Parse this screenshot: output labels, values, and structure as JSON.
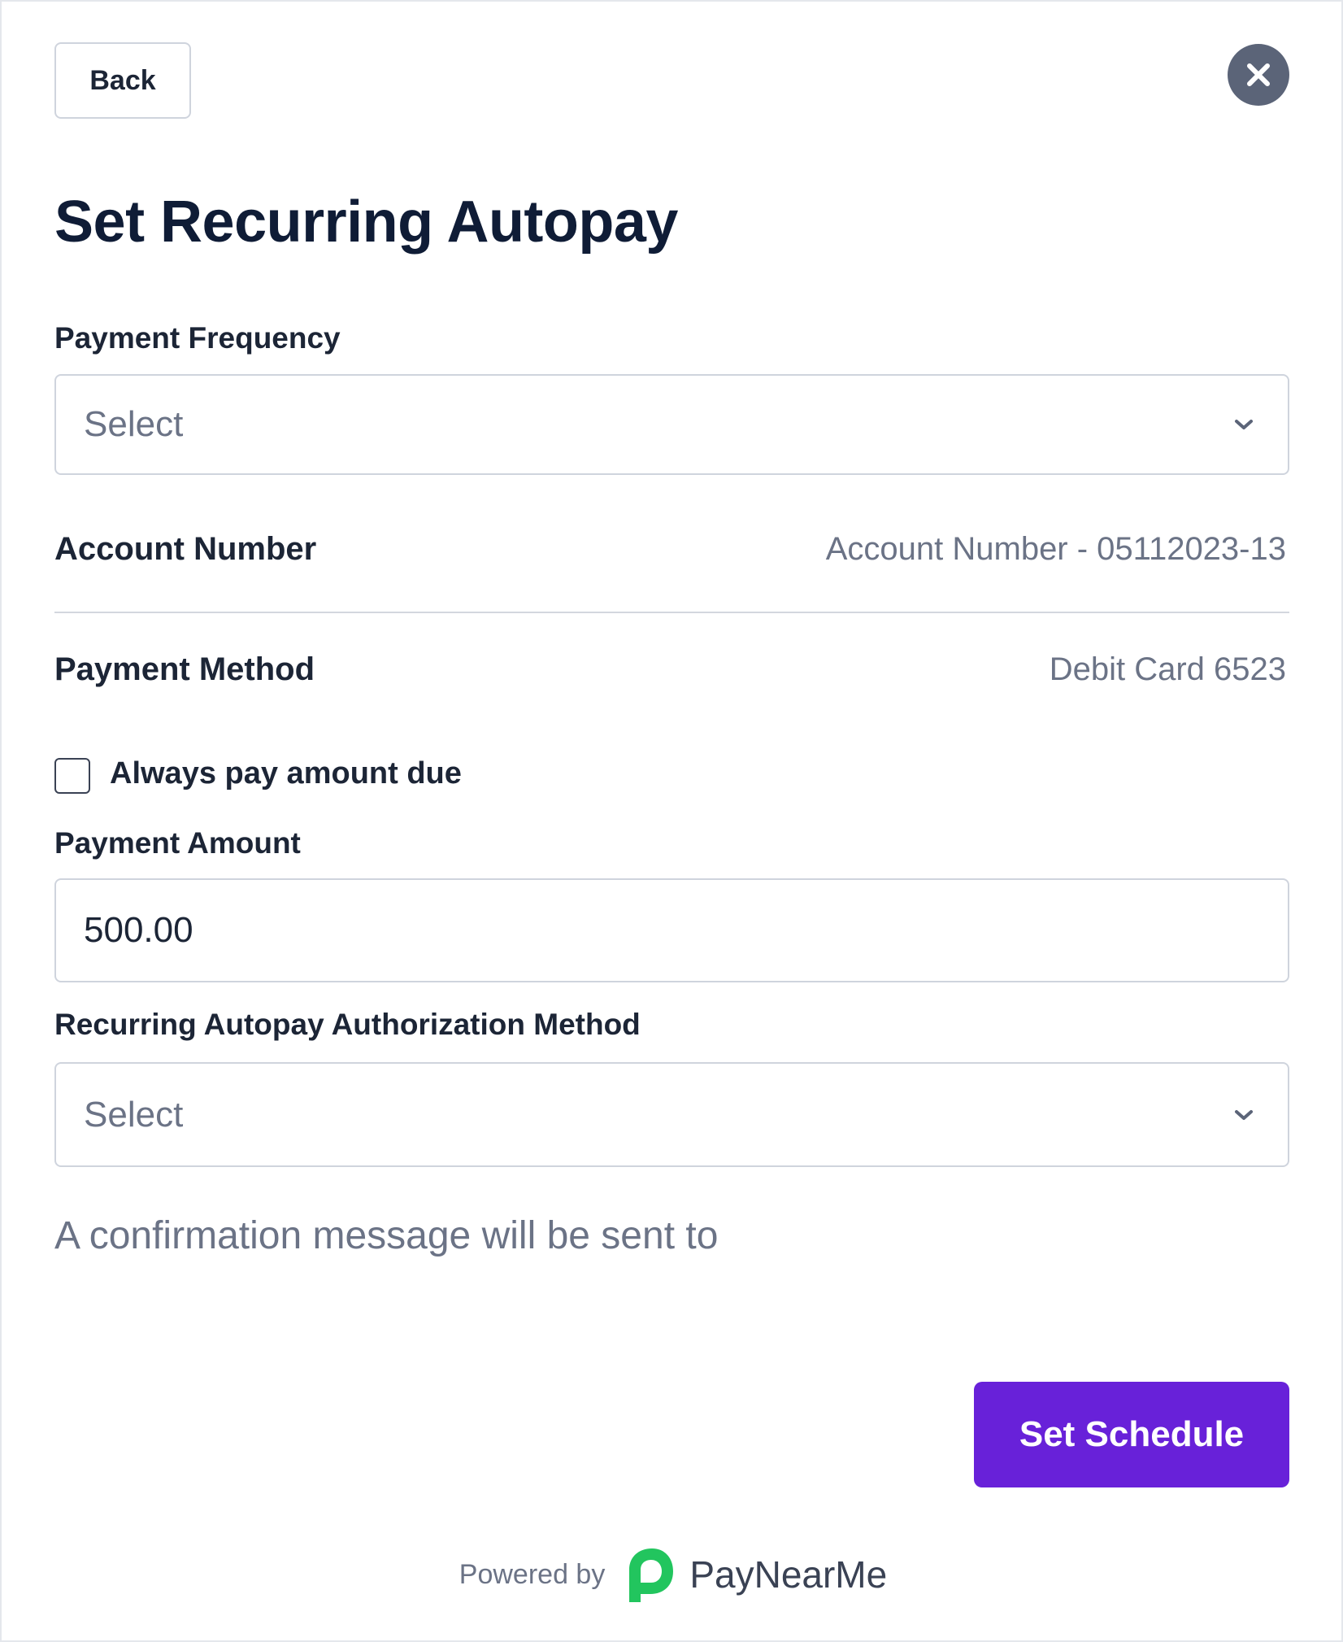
{
  "header": {
    "back_label": "Back",
    "close_icon": "close-icon",
    "title": "Set Recurring Autopay"
  },
  "form": {
    "frequency": {
      "label": "Payment Frequency",
      "value": "Select"
    },
    "account": {
      "label": "Account Number",
      "value": "Account Number - 05112023-13"
    },
    "payment_method": {
      "label": "Payment Method",
      "value": "Debit Card 6523"
    },
    "always_pay": {
      "label": "Always pay amount due",
      "checked": false
    },
    "amount": {
      "label": "Payment Amount",
      "value": "500.00"
    },
    "authorization": {
      "label": "Recurring Autopay Authorization Method",
      "value": "Select"
    },
    "confirmation_text": "A confirmation message will be sent to"
  },
  "actions": {
    "submit_label": "Set Schedule"
  },
  "footer": {
    "powered_by": "Powered by",
    "brand": "PayNearMe",
    "logo_icon": "paynearme-logo-icon"
  },
  "colors": {
    "primary": "#6821d9",
    "close_bg": "#5b6478",
    "brand_green": "#22c55e",
    "muted_text": "#6b7386",
    "border": "#cfd4dd"
  }
}
